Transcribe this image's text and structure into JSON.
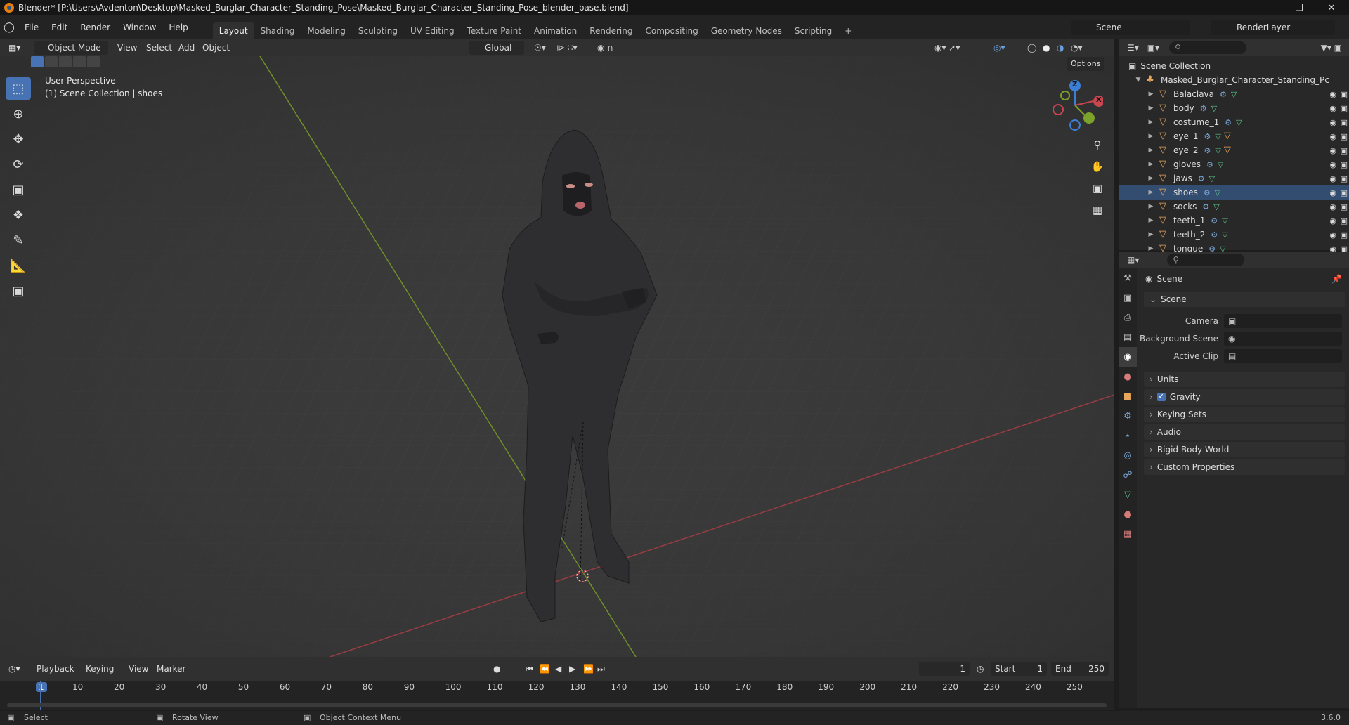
{
  "window": {
    "title": "Blender* [P:\\Users\\Avdenton\\Desktop\\Masked_Burglar_Character_Standing_Pose\\Masked_Burglar_Character_Standing_Pose_blender_base.blend]"
  },
  "menubar": {
    "items": [
      "File",
      "Edit",
      "Render",
      "Window",
      "Help"
    ],
    "workspaces": [
      "Layout",
      "Shading",
      "Modeling",
      "Sculpting",
      "UV Editing",
      "Texture Paint",
      "Animation",
      "Rendering",
      "Compositing",
      "Geometry Nodes",
      "Scripting"
    ],
    "scene_label": "Scene",
    "render_layer": "RenderLayer",
    "add_tab": "+"
  },
  "viewport_header": {
    "mode": "Object Mode",
    "menus": [
      "View",
      "Select",
      "Add",
      "Object"
    ],
    "orientation": "Global",
    "options": "Options"
  },
  "viewport": {
    "perspective": "User Perspective",
    "context": "(1) Scene Collection | shoes"
  },
  "gizmo": {
    "z": "Z",
    "y": "Y",
    "x": "X"
  },
  "outliner": {
    "root": "Scene Collection",
    "collection": "Masked_Burglar_Character_Standing_Pc",
    "objects": [
      "Balaclava",
      "body",
      "costume_1",
      "eye_1",
      "eye_2",
      "gloves",
      "jaws",
      "shoes",
      "socks",
      "teeth_1",
      "teeth_2",
      "tongue"
    ],
    "selected": "shoes"
  },
  "properties": {
    "context": "Scene",
    "panel": "Scene",
    "fields": [
      {
        "label": "Camera"
      },
      {
        "label": "Background Scene"
      },
      {
        "label": "Active Clip"
      }
    ],
    "panels": [
      "Units",
      "Gravity",
      "Keying Sets",
      "Audio",
      "Rigid Body World",
      "Custom Properties"
    ]
  },
  "timeline": {
    "menus": [
      "Playback",
      "Keying",
      "View",
      "Marker"
    ],
    "current": "1",
    "start_label": "Start",
    "start": "1",
    "end_label": "End",
    "end": "250",
    "ticks": [
      "1",
      "10",
      "20",
      "30",
      "40",
      "50",
      "60",
      "70",
      "80",
      "90",
      "100",
      "110",
      "120",
      "130",
      "140",
      "150",
      "160",
      "170",
      "180",
      "190",
      "200",
      "210",
      "220",
      "230",
      "240",
      "250"
    ]
  },
  "status": {
    "select": "Select",
    "rotate": "Rotate View",
    "context_menu": "Object Context Menu",
    "version": "3.6.0"
  },
  "colors": {
    "accent": "#4772b3",
    "x_axis": "#c8464f",
    "y_axis": "#7da22c",
    "z_axis": "#3d7fd6",
    "orange": "#e8a65c"
  }
}
